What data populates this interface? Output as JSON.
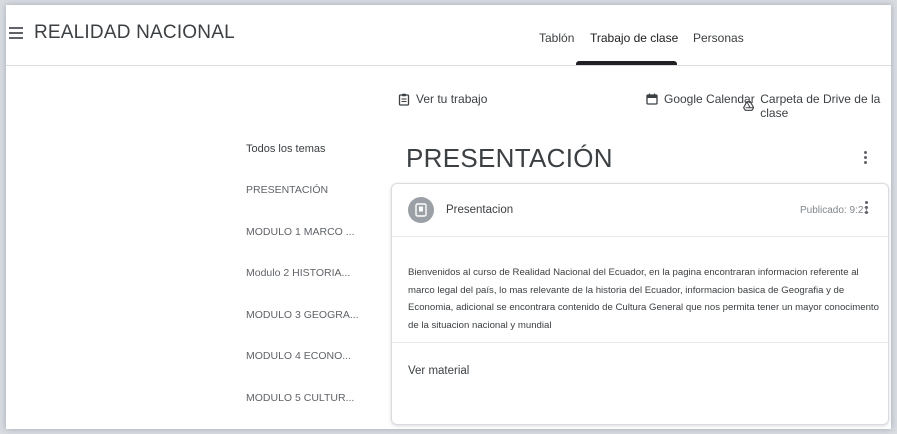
{
  "header": {
    "menu_icon": "hamburger-menu-icon",
    "class_title": "REALIDAD NACIONAL",
    "tabs": [
      {
        "label": "Tablón"
      },
      {
        "label": "Trabajo de clase"
      },
      {
        "label": "Personas"
      }
    ]
  },
  "toolbar": {
    "view_work_label": "Ver tu trabajo",
    "calendar_label": "Google Calendar",
    "drive_label": "Carpeta de Drive de la clase"
  },
  "sidebar": {
    "topics": [
      {
        "label": "Todos los temas"
      },
      {
        "label": "PRESENTACIÓN"
      },
      {
        "label": "MODULO 1 MARCO ..."
      },
      {
        "label": "Modulo 2 HISTORIA..."
      },
      {
        "label": "MODULO 3 GEOGRA..."
      },
      {
        "label": "MODULO 4 ECONO..."
      },
      {
        "label": "MODULO 5 CULTUR..."
      }
    ]
  },
  "main": {
    "topic_heading": "PRESENTACIÓN",
    "card": {
      "title": "Presentacion",
      "published": "Publicado: 9:21",
      "body": "Bienvenidos al curso de Realidad Nacional del Ecuador, en la pagina encontraran informacion referente al marco legal del país, lo mas relevante de la historia del Ecuador, informacion basica de  Geografia y de Economia, adicional se encontrara contenido de Cultura General  que nos permita tener un mayor conocimento de la situacion nacional y mundial",
      "view_material_label": "Ver material"
    }
  },
  "colors": {
    "text": "#3c4043",
    "active_tab_underline": "#202124",
    "divider": "#dadce0",
    "material_icon_bg": "#9aa0a6"
  }
}
